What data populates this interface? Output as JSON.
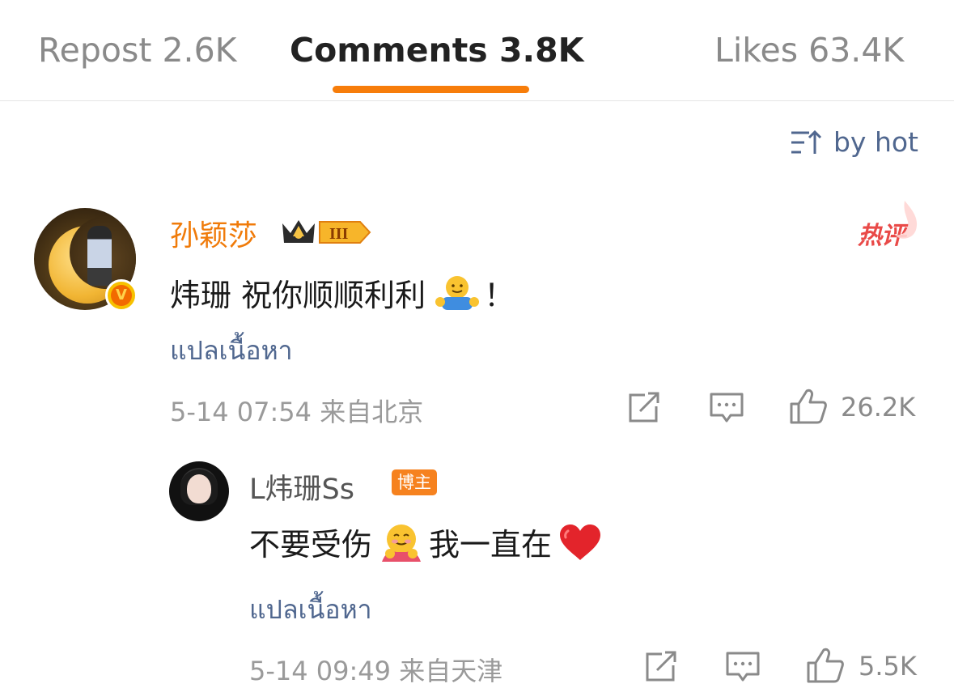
{
  "tabs": [
    {
      "label": "Repost 2.6K",
      "active": false
    },
    {
      "label": "Comments 3.8K",
      "active": true
    },
    {
      "label": "Likes 63.4K",
      "active": false
    }
  ],
  "sort": {
    "label": "by hot",
    "icon": "sort-icon"
  },
  "comment": {
    "user": "孙颖莎",
    "badge": "III",
    "hot_label": "热评",
    "text_before_emoji": "炜珊 祝你顺顺利利",
    "emoji": "hug-emoji",
    "text_after_emoji": "！",
    "translate": "แปลเนื้อหา",
    "meta": "5-14 07:54 来自北京",
    "likes": "26.2K"
  },
  "reply": {
    "user": "L炜珊Ss",
    "badge": "博主",
    "text_before_emoji": "不要受伤",
    "emoji": "hugging-face-emoji",
    "text_middle": "我一直在",
    "end_emoji": "red-heart-emoji",
    "translate": "แปลเนื้อหา",
    "meta": "5-14 09:49 来自天津",
    "likes": "5.5K"
  },
  "colors": {
    "accent_orange": "#f77d0a",
    "name_orange": "#f07b0a",
    "link_blue": "#50678f",
    "hot_red": "#e94a48"
  }
}
